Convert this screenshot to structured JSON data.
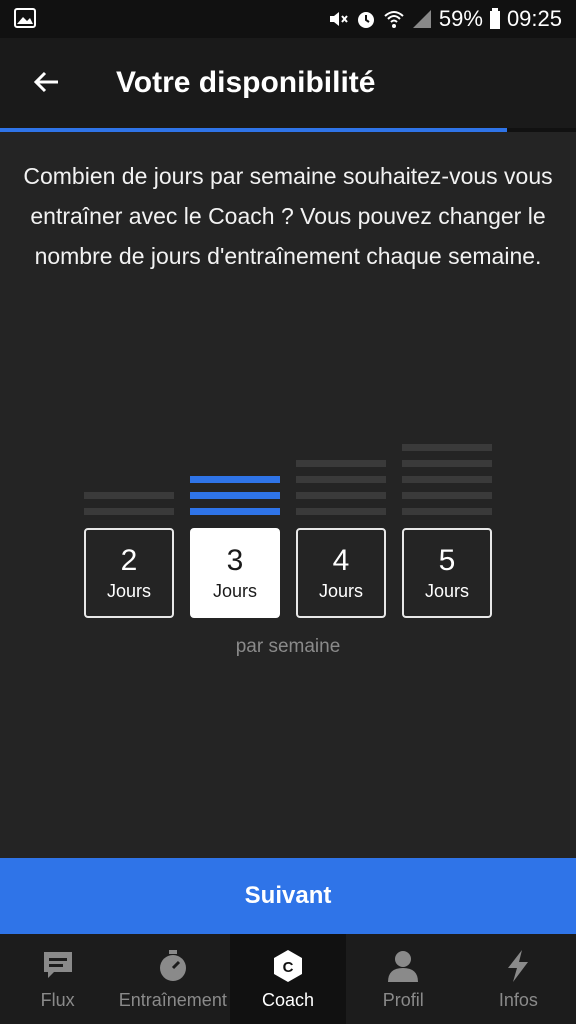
{
  "status_bar": {
    "battery": "59%",
    "time": "09:25",
    "icons": [
      "image-icon",
      "mute-icon",
      "alarm-icon",
      "wifi-icon",
      "signal-icon",
      "battery-icon"
    ]
  },
  "header": {
    "title": "Votre disponibilité",
    "progress": 0.88,
    "accent": "#2f74e8"
  },
  "question": "Combien de jours par semaine souhaitez-vous vous entraîner avec le Coach ? Vous pouvez changer le nombre de jours d'entraînement chaque semaine.",
  "days": {
    "options": [
      {
        "number": "2",
        "unit": "Jours"
      },
      {
        "number": "3",
        "unit": "Jours"
      },
      {
        "number": "4",
        "unit": "Jours"
      },
      {
        "number": "5",
        "unit": "Jours"
      }
    ],
    "selected": "3",
    "caption": "par semaine"
  },
  "next_label": "Suivant",
  "bottom_nav": {
    "items": [
      {
        "label": "Flux",
        "icon": "chat-icon"
      },
      {
        "label": "Entraînement",
        "icon": "stopwatch-icon"
      },
      {
        "label": "Coach",
        "icon": "coach-icon"
      },
      {
        "label": "Profil",
        "icon": "person-icon"
      },
      {
        "label": "Infos",
        "icon": "lightning-icon"
      }
    ],
    "active": "Coach"
  }
}
